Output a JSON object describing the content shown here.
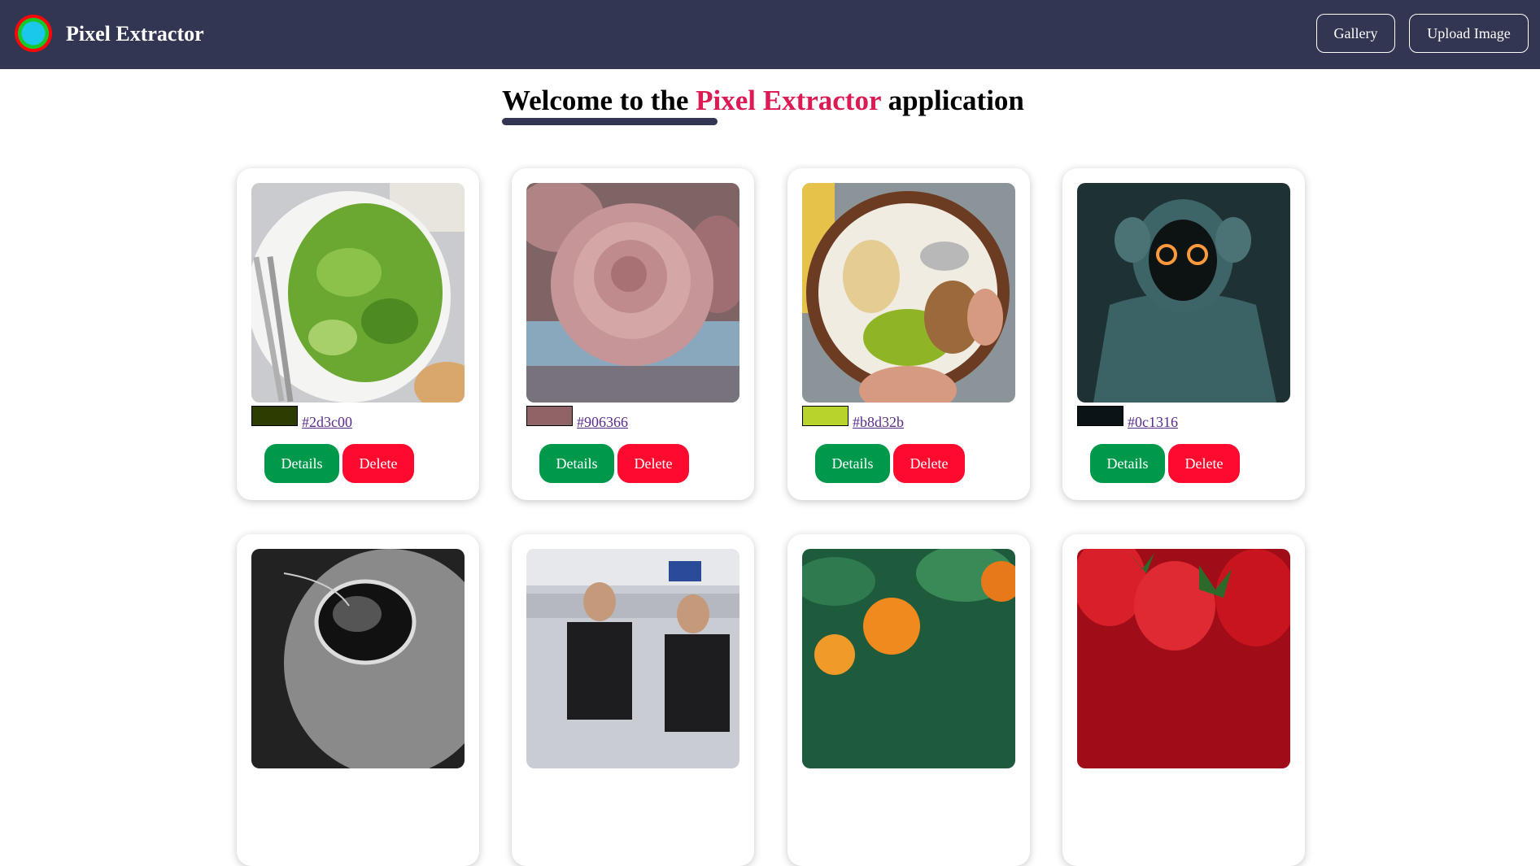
{
  "header": {
    "logo_icon": "color-wheel-icon",
    "title": "Pixel Extractor",
    "gallery_label": "Gallery",
    "upload_label": "Upload Image"
  },
  "welcome": {
    "prefix": "Welcome to the",
    "accent": "Pixel Extractor",
    "suffix": "application",
    "accent_color": "#dc1a54"
  },
  "theme": {
    "navbar_color": "#333652",
    "details_color": "#00994c",
    "delete_color": "#ff0a2f"
  },
  "cards": [
    {
      "image": "green-salad-plate",
      "color": "#2d3c00",
      "hex": "#2d3c00",
      "details_label": "Details",
      "delete_label": "Delete"
    },
    {
      "image": "pink-rose-flower",
      "color": "#906366",
      "hex": "#906366",
      "details_label": "Details",
      "delete_label": "Delete"
    },
    {
      "image": "yogurt-fruit-bowl",
      "color": "#b8d32b",
      "hex": "#b8d32b",
      "details_label": "Details",
      "delete_label": "Delete"
    },
    {
      "image": "hooded-figure-glowing-eyes",
      "color": "#0c1316",
      "hex": "#0c1316",
      "details_label": "Details",
      "delete_label": "Delete"
    },
    {
      "image": "cat-with-sunglasses-bw"
    },
    {
      "image": "two-men-in-office"
    },
    {
      "image": "tangerines-on-tree"
    },
    {
      "image": "strawberries-closeup"
    }
  ]
}
